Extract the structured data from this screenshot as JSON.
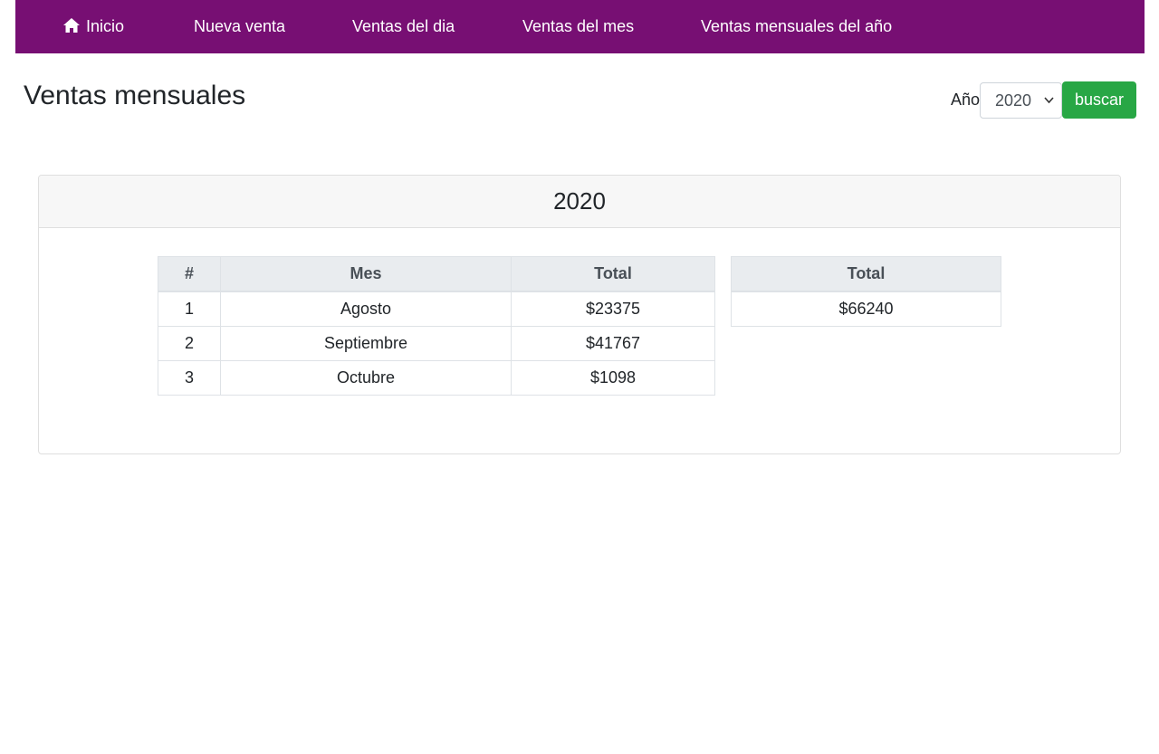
{
  "nav": {
    "items": [
      {
        "label": "Inicio",
        "icon": "home-icon"
      },
      {
        "label": "Nueva venta"
      },
      {
        "label": "Ventas del dia"
      },
      {
        "label": "Ventas del mes"
      },
      {
        "label": "Ventas mensuales del año"
      }
    ],
    "background": "#770f73"
  },
  "page": {
    "title": "Ventas mensuales",
    "year_label": "Año",
    "year_value": "2020",
    "search_label": "buscar"
  },
  "card": {
    "header": "2020",
    "months_table": {
      "headers": [
        "#",
        "Mes",
        "Total"
      ],
      "rows": [
        [
          "1",
          "Agosto",
          "$23375"
        ],
        [
          "2",
          "Septiembre",
          "$41767"
        ],
        [
          "3",
          "Octubre",
          "$1098"
        ]
      ]
    },
    "total_table": {
      "header": "Total",
      "value": "$66240"
    }
  },
  "colors": {
    "accent": "#770f73",
    "success": "#28a745"
  }
}
